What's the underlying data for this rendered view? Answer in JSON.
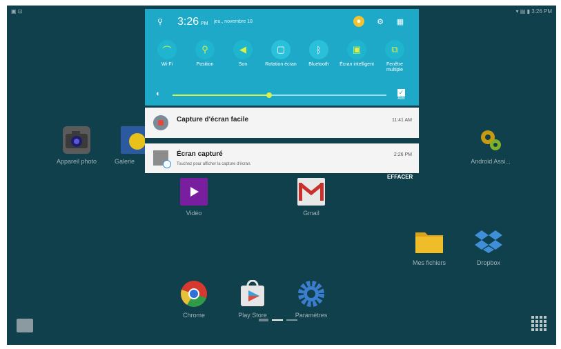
{
  "colors": {
    "background": "#10404b",
    "quick_settings": "#1da9c7",
    "accent": "#d7f04a",
    "notification_bg": "#f4f4f4"
  },
  "status_bar": {
    "time": "3:26 PM"
  },
  "quick_settings": {
    "time": "3:26",
    "ampm": "PM",
    "date": "jeu., novembre 18",
    "toggles": [
      {
        "label": "Wi-Fi",
        "icon": "wifi-icon",
        "on": true
      },
      {
        "label": "Position",
        "icon": "location-icon",
        "on": true
      },
      {
        "label": "Son",
        "icon": "sound-icon",
        "on": true
      },
      {
        "label": "Rotation écran",
        "icon": "rotation-icon",
        "on": false
      },
      {
        "label": "Bluetooth",
        "icon": "bluetooth-icon",
        "on": false
      },
      {
        "label": "Écran intelligent",
        "icon": "smart-screen-icon",
        "on": false
      },
      {
        "label": "Fenêtre multiple",
        "icon": "multi-window-icon",
        "on": false
      }
    ],
    "brightness_fraction": 0.45,
    "auto_label": "Auto"
  },
  "notifications": [
    {
      "title": "Capture d'écran facile",
      "subtitle": "",
      "time": "11:41 AM",
      "icon": "screen-capture-app-icon"
    },
    {
      "title": "Écran capturé",
      "subtitle": "Touchez pour afficher la capture d'écran.",
      "time": "2:26 PM",
      "icon": "screenshot-thumbnail-icon"
    }
  ],
  "clear_label": "EFFACER",
  "apps": [
    {
      "label": "Appareil photo",
      "icon": "camera-icon"
    },
    {
      "label": "Galerie",
      "icon": "gallery-icon"
    },
    {
      "label": "Android Assi...",
      "icon": "android-assistant-icon"
    },
    {
      "label": "Vidéo",
      "icon": "video-icon"
    },
    {
      "label": "Gmail",
      "icon": "gmail-icon"
    },
    {
      "label": "Mes fichiers",
      "icon": "folder-icon"
    },
    {
      "label": "Dropbox",
      "icon": "dropbox-icon"
    },
    {
      "label": "Chrome",
      "icon": "chrome-icon"
    },
    {
      "label": "Play Store",
      "icon": "play-store-icon"
    },
    {
      "label": "Paramètres",
      "icon": "settings-icon"
    }
  ]
}
